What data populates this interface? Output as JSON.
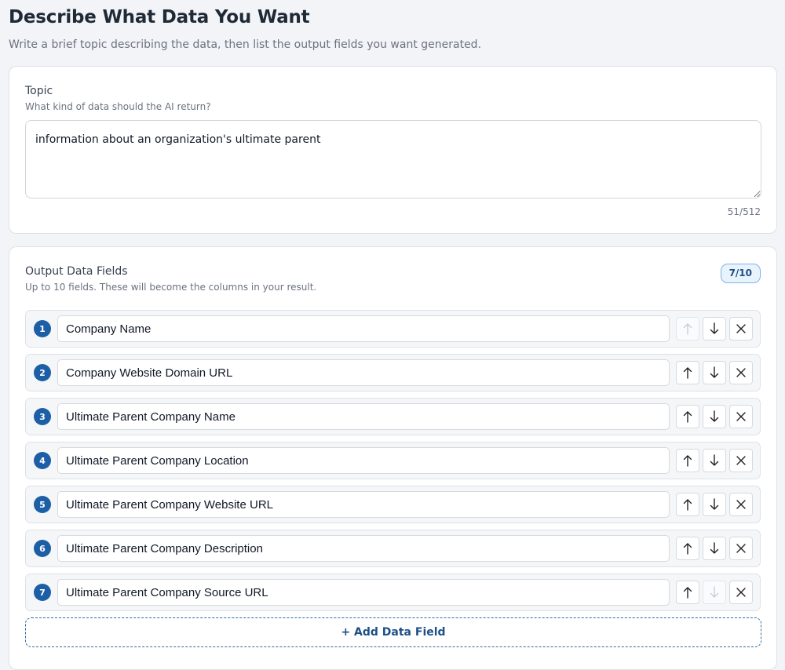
{
  "header": {
    "title": "Describe What Data You Want",
    "subtitle": "Write a brief topic describing the data, then list the output fields you want generated."
  },
  "topic": {
    "label": "Topic",
    "description": "What kind of data should the AI return?",
    "value": "information about an organization's ultimate parent",
    "char_count": "51/512"
  },
  "fields": {
    "label": "Output Data Fields",
    "description": "Up to 10 fields. These will become the columns in your result.",
    "count": "7/10",
    "items": [
      {
        "number": "1",
        "value": "Company Name",
        "up_disabled": true,
        "down_disabled": false
      },
      {
        "number": "2",
        "value": "Company Website Domain URL",
        "up_disabled": false,
        "down_disabled": false
      },
      {
        "number": "3",
        "value": "Ultimate Parent Company Name",
        "up_disabled": false,
        "down_disabled": false
      },
      {
        "number": "4",
        "value": "Ultimate Parent Company Location",
        "up_disabled": false,
        "down_disabled": false
      },
      {
        "number": "5",
        "value": "Ultimate Parent Company Website URL",
        "up_disabled": false,
        "down_disabled": false
      },
      {
        "number": "6",
        "value": "Ultimate Parent Company Description",
        "up_disabled": false,
        "down_disabled": false
      },
      {
        "number": "7",
        "value": "Ultimate Parent Company Source URL",
        "up_disabled": false,
        "down_disabled": true
      }
    ],
    "add_label": "+ Add Data Field"
  },
  "icons": {
    "move_up": "arrow-up-icon",
    "move_down": "arrow-down-icon",
    "remove": "close-icon"
  },
  "colors": {
    "accent": "#1d5fa6",
    "badge_border": "#7cb4e6",
    "badge_bg": "#e8f3fc"
  }
}
